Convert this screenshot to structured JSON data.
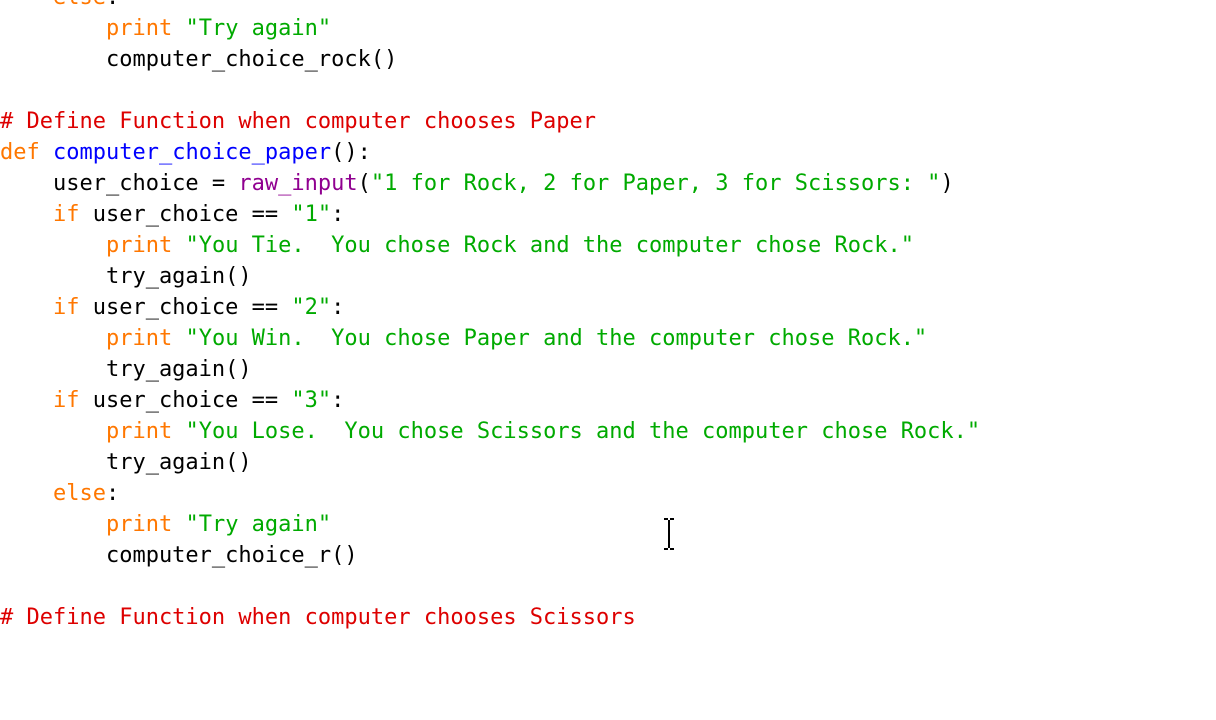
{
  "colors": {
    "keyword": "#ff7700",
    "string": "#00aa00",
    "comment": "#dd0000",
    "builtin": "#900090",
    "function_name": "#0000ff",
    "plain": "#000000",
    "background": "#ffffff"
  },
  "cursor_icon": "text-ibeam-cursor",
  "lines": [
    [
      {
        "t": "    ",
        "c": "plain"
      },
      {
        "t": "else",
        "c": "keyword"
      },
      {
        "t": ":",
        "c": "plain"
      }
    ],
    [
      {
        "t": "        ",
        "c": "plain"
      },
      {
        "t": "print",
        "c": "keyword"
      },
      {
        "t": " ",
        "c": "plain"
      },
      {
        "t": "\"Try again\"",
        "c": "string"
      }
    ],
    [
      {
        "t": "        computer_choice_rock()",
        "c": "plain"
      }
    ],
    [],
    [
      {
        "t": "# Define Function when computer chooses Paper",
        "c": "comment"
      }
    ],
    [
      {
        "t": "def",
        "c": "keyword"
      },
      {
        "t": " ",
        "c": "plain"
      },
      {
        "t": "computer_choice_paper",
        "c": "defname"
      },
      {
        "t": "():",
        "c": "plain"
      }
    ],
    [
      {
        "t": "    user_choice = ",
        "c": "plain"
      },
      {
        "t": "raw_input",
        "c": "builtin"
      },
      {
        "t": "(",
        "c": "plain"
      },
      {
        "t": "\"1 for Rock, 2 for Paper, 3 for Scissors: \"",
        "c": "string"
      },
      {
        "t": ")",
        "c": "plain"
      }
    ],
    [
      {
        "t": "    ",
        "c": "plain"
      },
      {
        "t": "if",
        "c": "keyword"
      },
      {
        "t": " user_choice == ",
        "c": "plain"
      },
      {
        "t": "\"1\"",
        "c": "string"
      },
      {
        "t": ":",
        "c": "plain"
      }
    ],
    [
      {
        "t": "        ",
        "c": "plain"
      },
      {
        "t": "print",
        "c": "keyword"
      },
      {
        "t": " ",
        "c": "plain"
      },
      {
        "t": "\"You Tie.  You chose Rock and the computer chose Rock.\"",
        "c": "string"
      }
    ],
    [
      {
        "t": "        try_again()",
        "c": "plain"
      }
    ],
    [
      {
        "t": "    ",
        "c": "plain"
      },
      {
        "t": "if",
        "c": "keyword"
      },
      {
        "t": " user_choice == ",
        "c": "plain"
      },
      {
        "t": "\"2\"",
        "c": "string"
      },
      {
        "t": ":",
        "c": "plain"
      }
    ],
    [
      {
        "t": "        ",
        "c": "plain"
      },
      {
        "t": "print",
        "c": "keyword"
      },
      {
        "t": " ",
        "c": "plain"
      },
      {
        "t": "\"You Win.  You chose Paper and the computer chose Rock.\"",
        "c": "string"
      }
    ],
    [
      {
        "t": "        try_again()",
        "c": "plain"
      }
    ],
    [
      {
        "t": "    ",
        "c": "plain"
      },
      {
        "t": "if",
        "c": "keyword"
      },
      {
        "t": " user_choice == ",
        "c": "plain"
      },
      {
        "t": "\"3\"",
        "c": "string"
      },
      {
        "t": ":",
        "c": "plain"
      }
    ],
    [
      {
        "t": "        ",
        "c": "plain"
      },
      {
        "t": "print",
        "c": "keyword"
      },
      {
        "t": " ",
        "c": "plain"
      },
      {
        "t": "\"You Lose.  You chose Scissors and the computer chose Rock.\"",
        "c": "string"
      }
    ],
    [
      {
        "t": "        try_again()",
        "c": "plain"
      }
    ],
    [
      {
        "t": "    ",
        "c": "plain"
      },
      {
        "t": "else",
        "c": "keyword"
      },
      {
        "t": ":",
        "c": "plain"
      }
    ],
    [
      {
        "t": "        ",
        "c": "plain"
      },
      {
        "t": "print",
        "c": "keyword"
      },
      {
        "t": " ",
        "c": "plain"
      },
      {
        "t": "\"Try again\"",
        "c": "string"
      }
    ],
    [
      {
        "t": "        computer_choice_r()",
        "c": "plain"
      }
    ],
    [],
    [
      {
        "t": "# Define Function when computer chooses Scissors",
        "c": "comment"
      }
    ],
    [],
    []
  ]
}
